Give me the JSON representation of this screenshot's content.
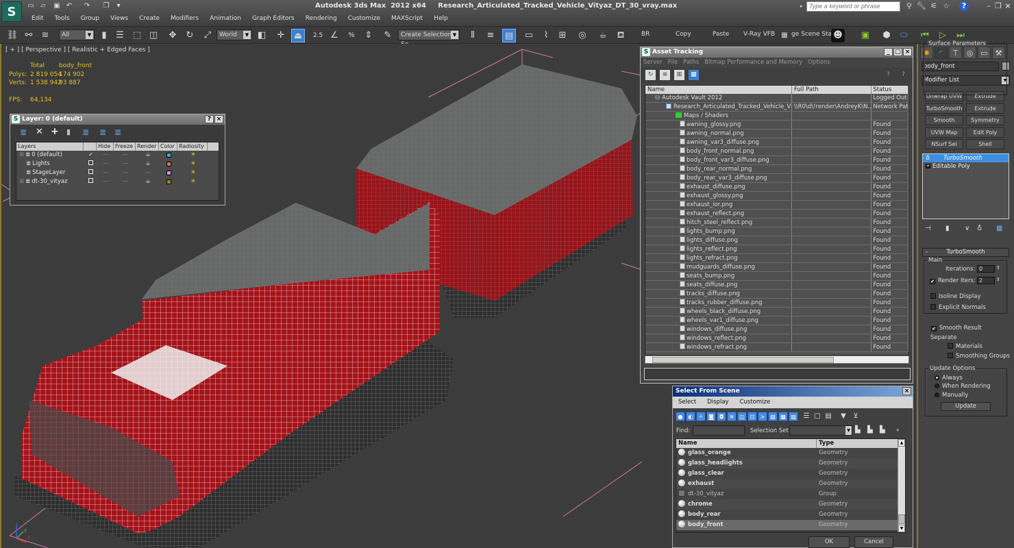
{
  "window": {
    "title": "Autodesk 3ds Max  2012 x64     Research_Articulated_Tracked_Vehicle_Vityaz_DT_30_vray.max",
    "search_placeholder": "Type a keyword or phrase"
  },
  "menu": [
    "Edit",
    "Tools",
    "Group",
    "Views",
    "Create",
    "Modifiers",
    "Animation",
    "Graph Editors",
    "Rendering",
    "Customize",
    "MAXScript",
    "Help"
  ],
  "toolbar": {
    "selection_filter": "All",
    "reference_coord": "World",
    "snap_angle": "2.5",
    "named_selection_placeholder": "Create Selection Se",
    "br_label": "BR",
    "copy_label": "Copy",
    "paste_label": "Paste",
    "vray_vfb_label": "V-Ray VFB",
    "scene_states_label": "ge Scene Stat"
  },
  "viewport": {
    "label": "[ + ] [ Perspective ] [ Realistic + Edged Faces ]",
    "stats": {
      "header_total": "Total",
      "header_object": "body_front",
      "polys_label": "Polys:",
      "polys_total": "2 819 054",
      "polys_object": "174 902",
      "verts_label": "Verts:",
      "verts_total": "1 538 942",
      "verts_object": "93 887",
      "fps_label": "FPS:",
      "fps_value": "64,134"
    },
    "axis": {
      "x": "x",
      "y": "y",
      "z": "z"
    }
  },
  "layer_dialog": {
    "title": "Layer: 0 (default)",
    "columns": [
      "Layers",
      "",
      "Hide",
      "Freeze",
      "Render",
      "Color",
      "Radiosity"
    ],
    "rows": [
      {
        "name": "0 (default)",
        "expandable": true,
        "current": true,
        "color": "#2ab4e0",
        "render": true
      },
      {
        "name": "Lights",
        "expandable": false,
        "current": false,
        "color": "#e07840",
        "render": true
      },
      {
        "name": "StageLayer",
        "expandable": false,
        "current": false,
        "color": "#d090e0",
        "render": false
      },
      {
        "name": "dt-30_vityaz",
        "expandable": true,
        "current": false,
        "color": "#a08a10",
        "render": true
      }
    ]
  },
  "asset_tracking": {
    "title": "Asset Tracking",
    "menu": [
      "Server",
      "File",
      "Paths",
      "Bitmap Performance and Memory",
      "Options"
    ],
    "columns": [
      "Name",
      "Full Path",
      "Status"
    ],
    "rows": [
      {
        "name": "Autodesk Vault 2012",
        "path": "",
        "status": "Logged Out (",
        "level": 1
      },
      {
        "name": "Research_Articulated_Tracked_Vehicle_Vit...",
        "path": "\\\\R0\\d\\!render\\AndreyK\\N...",
        "status": "Network Path",
        "level": 2
      },
      {
        "name": "Maps / Shaders",
        "path": "",
        "status": "",
        "level": 3
      },
      {
        "name": "awning_glossy.png",
        "path": "",
        "status": "Found",
        "level": 4
      },
      {
        "name": "awning_normal.png",
        "path": "",
        "status": "Found",
        "level": 4
      },
      {
        "name": "awning_var3_diffuse.png",
        "path": "",
        "status": "Found",
        "level": 4
      },
      {
        "name": "body_front_normal.png",
        "path": "",
        "status": "Found",
        "level": 4
      },
      {
        "name": "body_front_var3_diffuse.png",
        "path": "",
        "status": "Found",
        "level": 4
      },
      {
        "name": "body_rear_normal.png",
        "path": "",
        "status": "Found",
        "level": 4
      },
      {
        "name": "body_rear_var3_diffuse.png",
        "path": "",
        "status": "Found",
        "level": 4
      },
      {
        "name": "exhaust_diffuse.png",
        "path": "",
        "status": "Found",
        "level": 4
      },
      {
        "name": "exhaust_glossy.png",
        "path": "",
        "status": "Found",
        "level": 4
      },
      {
        "name": "exhaust_ior.png",
        "path": "",
        "status": "Found",
        "level": 4
      },
      {
        "name": "exhaust_reflect.png",
        "path": "",
        "status": "Found",
        "level": 4
      },
      {
        "name": "hitch_steel_reflect.png",
        "path": "",
        "status": "Found",
        "level": 4
      },
      {
        "name": "lights_bump.png",
        "path": "",
        "status": "Found",
        "level": 4
      },
      {
        "name": "lights_diffuse.png",
        "path": "",
        "status": "Found",
        "level": 4
      },
      {
        "name": "lights_reflect.png",
        "path": "",
        "status": "Found",
        "level": 4
      },
      {
        "name": "lights_refract.png",
        "path": "",
        "status": "Found",
        "level": 4
      },
      {
        "name": "mudguards_diffuse.png",
        "path": "",
        "status": "Found",
        "level": 4
      },
      {
        "name": "seats_bump.png",
        "path": "",
        "status": "Found",
        "level": 4
      },
      {
        "name": "seats_diffuse.png",
        "path": "",
        "status": "Found",
        "level": 4
      },
      {
        "name": "tracks_diffuse.png",
        "path": "",
        "status": "Found",
        "level": 4
      },
      {
        "name": "tracks_rubber_diffuse.png",
        "path": "",
        "status": "Found",
        "level": 4
      },
      {
        "name": "wheels_black_diffuse.png",
        "path": "",
        "status": "Found",
        "level": 4
      },
      {
        "name": "wheels_var1_diffuse.png",
        "path": "",
        "status": "Found",
        "level": 4
      },
      {
        "name": "windows_diffuse.png",
        "path": "",
        "status": "Found",
        "level": 4
      },
      {
        "name": "windows_reflect.png",
        "path": "",
        "status": "Found",
        "level": 4
      },
      {
        "name": "windows_refract.png",
        "path": "",
        "status": "Found",
        "level": 4
      }
    ]
  },
  "select_from_scene": {
    "title": "Select From Scene",
    "menu": [
      "Select",
      "Display",
      "Customize"
    ],
    "find_label": "Find:",
    "find_value": "",
    "selection_set_label": "Selection Set:",
    "selection_set_value": "",
    "columns": [
      "Name",
      "Type"
    ],
    "rows": [
      {
        "name": "glass_orange",
        "type": "Geometry",
        "group": false,
        "selected": false
      },
      {
        "name": "glass_headlights",
        "type": "Geometry",
        "group": false,
        "selected": false
      },
      {
        "name": "glass_clear",
        "type": "Geometry",
        "group": false,
        "selected": false
      },
      {
        "name": "exhaust",
        "type": "Geometry",
        "group": false,
        "selected": false
      },
      {
        "name": "dt-30_vityaz",
        "type": "Group",
        "group": true,
        "selected": false
      },
      {
        "name": "chrome",
        "type": "Geometry",
        "group": false,
        "selected": false
      },
      {
        "name": "body_rear",
        "type": "Geometry",
        "group": false,
        "selected": false
      },
      {
        "name": "body_front",
        "type": "Geometry",
        "group": false,
        "selected": true
      }
    ],
    "ok_label": "OK",
    "cancel_label": "Cancel"
  },
  "command_panel": {
    "object_name": "body_front",
    "modifier_list_label": "Modifier List",
    "modifier_buttons": [
      "Unwrap UVW",
      "Extrude",
      "TurboSmooth",
      "Extrude",
      "Smooth",
      "Symmetry",
      "UVW Map",
      "Edit Poly",
      "NSurf Sel",
      "Shell"
    ],
    "stack": [
      {
        "name": "TurboSmooth",
        "selected": true
      },
      {
        "name": "Editable Poly",
        "selected": false
      }
    ],
    "rollout_title": "TurboSmooth",
    "main_group": "Main",
    "iterations_label": "Iterations:",
    "iterations_value": "0",
    "render_iters_label": "Render Iters:",
    "render_iters_value": "2",
    "render_iters_checked": true,
    "isoline_label": "Isoline Display",
    "isoline_checked": false,
    "explicit_normals_label": "Explicit Normals",
    "explicit_normals_checked": false,
    "surface_group": "Surface Parameters",
    "smooth_result_label": "Smooth Result",
    "smooth_result_checked": true,
    "separate_label": "Separate",
    "materials_label": "Materials",
    "materials_checked": false,
    "smoothing_groups_label": "Smoothing Groups",
    "smoothing_groups_checked": false,
    "update_group": "Update Options",
    "update_options": [
      "Always",
      "When Rendering",
      "Manually"
    ],
    "update_selected": "Always",
    "update_button": "Update"
  }
}
